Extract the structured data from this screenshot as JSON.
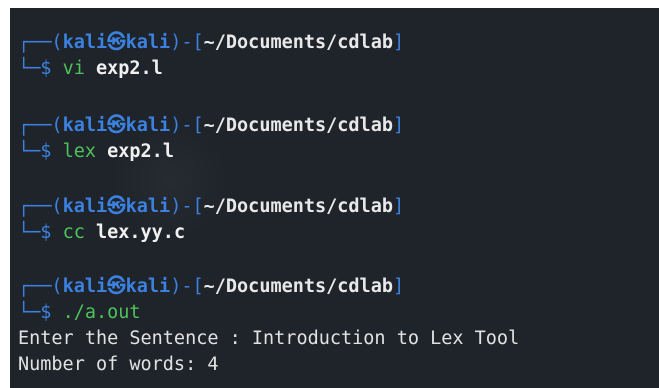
{
  "terminal": {
    "prompt_user": "kali",
    "prompt_at_icon": "kali-skull-icon",
    "prompt_at_glyph": "㉿",
    "prompt_host": "kali",
    "prompt_path": "~/Documents/cdlab",
    "prompt_symbol": "$",
    "commands": [
      {
        "cmd": "vi",
        "arg": "exp2.l"
      },
      {
        "cmd": "lex",
        "arg": "exp2.l"
      },
      {
        "cmd": "cc",
        "arg": "lex.yy.c"
      },
      {
        "cmd": "./a.out",
        "arg": ""
      }
    ],
    "output": [
      "Enter the Sentence : Introduction to Lex Tool",
      "Number of words: 4"
    ]
  },
  "colors": {
    "background": "#1f232a",
    "prompt_blue": "#3b82e0",
    "command_green": "#4ec35a",
    "text": "#e2e2e2"
  }
}
